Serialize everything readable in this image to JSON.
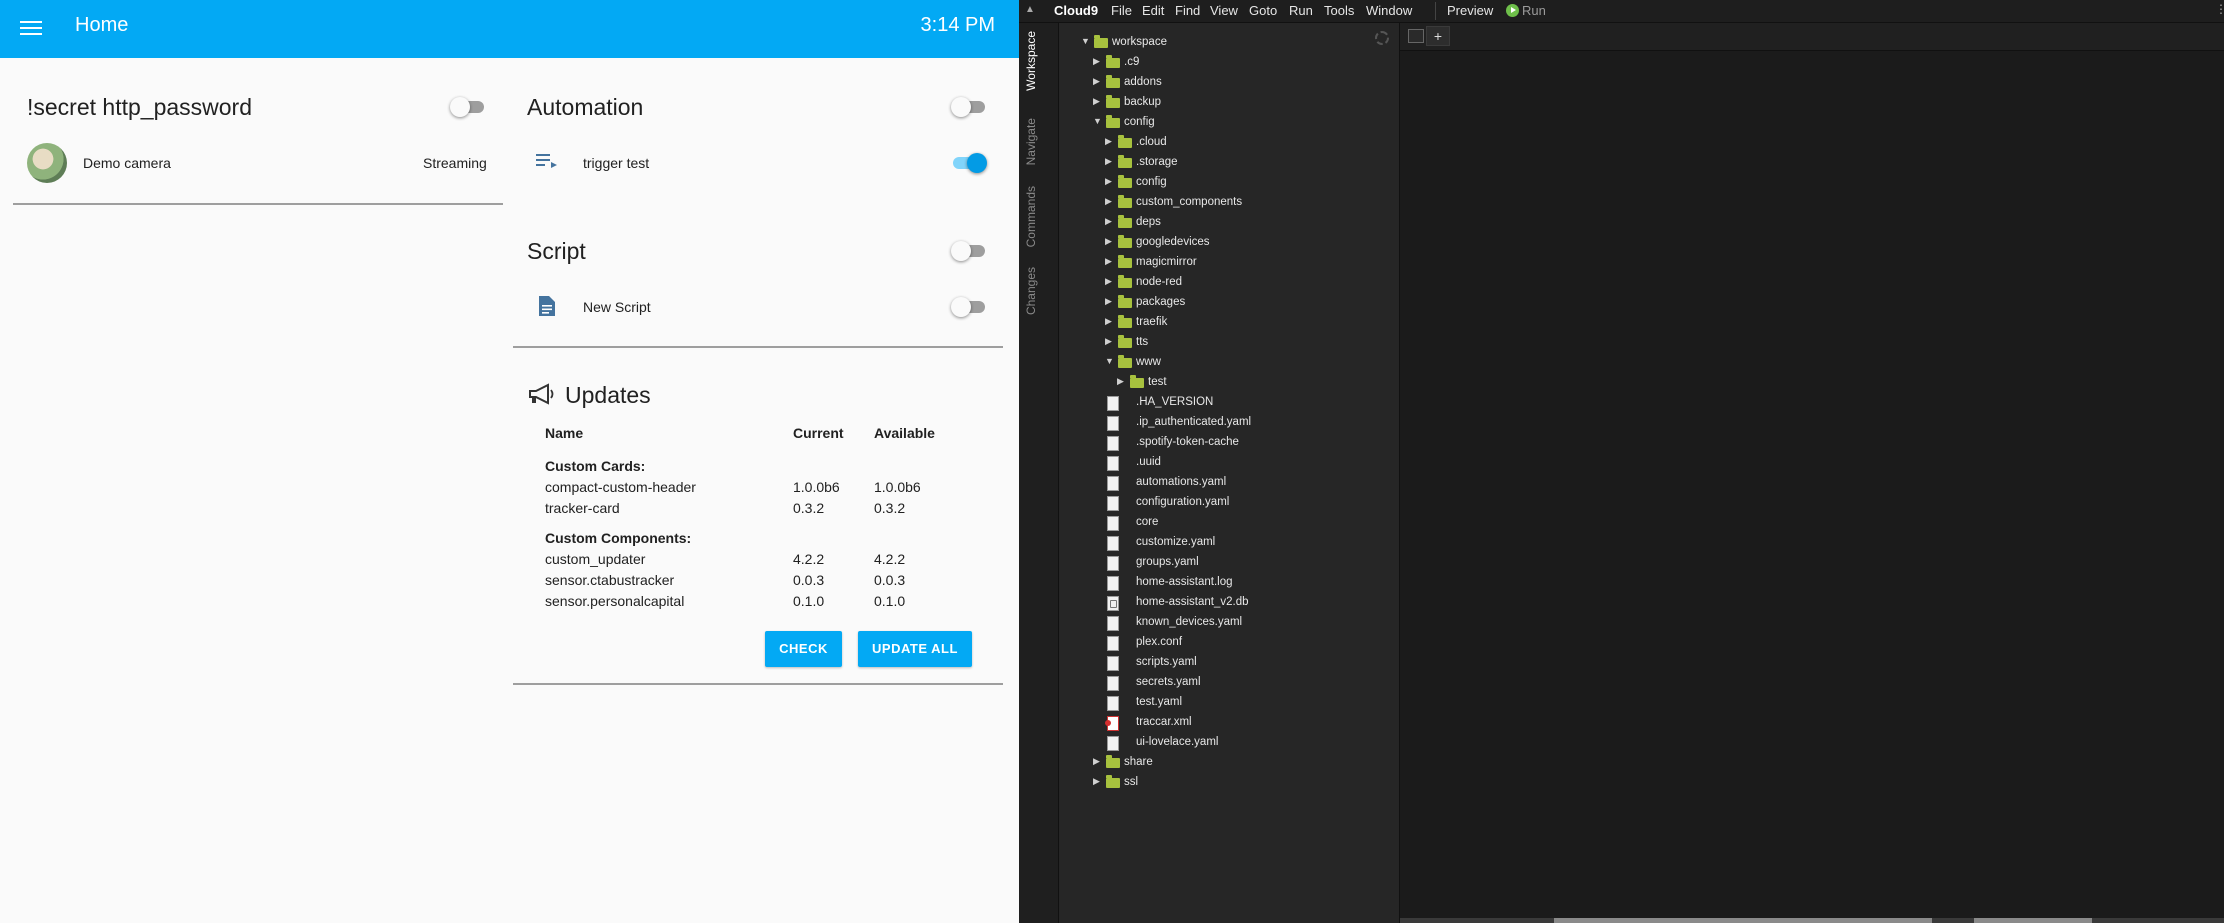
{
  "ha": {
    "header": {
      "title": "Home",
      "clock": "3:14 PM"
    },
    "cards": {
      "secret": {
        "title": "!secret http_password",
        "row_label": "Demo camera",
        "row_state": "Streaming"
      },
      "automation": {
        "title": "Automation",
        "row_label": "trigger test"
      },
      "script": {
        "title": "Script",
        "row_label": "New Script"
      },
      "updates": {
        "title": "Updates",
        "headers": {
          "name": "Name",
          "current": "Current",
          "available": "Available"
        },
        "sections": [
          {
            "label": "Custom Cards:",
            "items": [
              {
                "name": "compact-custom-header",
                "current": "1.0.0b6",
                "available": "1.0.0b6"
              },
              {
                "name": "tracker-card",
                "current": "0.3.2",
                "available": "0.3.2"
              }
            ]
          },
          {
            "label": "Custom Components:",
            "items": [
              {
                "name": "custom_updater",
                "current": "4.2.2",
                "available": "4.2.2"
              },
              {
                "name": "sensor.ctabustracker",
                "current": "0.0.3",
                "available": "0.0.3"
              },
              {
                "name": "sensor.personalcapital",
                "current": "0.1.0",
                "available": "0.1.0"
              }
            ]
          }
        ],
        "buttons": {
          "check": "CHECK",
          "update_all": "UPDATE ALL"
        }
      }
    },
    "toggles": {
      "secret_header": false,
      "automation_header": false,
      "trigger_test": true,
      "script_header": false,
      "new_script": false
    },
    "colors": {
      "accent": "#03a9f4",
      "toggle_on": "#039be5"
    }
  },
  "c9": {
    "menu": [
      "Cloud9",
      "File",
      "Edit",
      "Find",
      "View",
      "Goto",
      "Run",
      "Tools",
      "Window"
    ],
    "preview": "Preview",
    "run": "Run",
    "side_tabs": [
      "Workspace",
      "Navigate",
      "Commands",
      "Changes"
    ],
    "tree": [
      {
        "label": "workspace",
        "type": "folder",
        "depth": 0,
        "open": true
      },
      {
        "label": ".c9",
        "type": "folder",
        "depth": 1,
        "open": false
      },
      {
        "label": "addons",
        "type": "folder",
        "depth": 1,
        "open": false
      },
      {
        "label": "backup",
        "type": "folder",
        "depth": 1,
        "open": false
      },
      {
        "label": "config",
        "type": "folder",
        "depth": 1,
        "open": true
      },
      {
        "label": ".cloud",
        "type": "folder",
        "depth": 2,
        "open": false
      },
      {
        "label": ".storage",
        "type": "folder",
        "depth": 2,
        "open": false
      },
      {
        "label": "config",
        "type": "folder",
        "depth": 2,
        "open": false
      },
      {
        "label": "custom_components",
        "type": "folder",
        "depth": 2,
        "open": false
      },
      {
        "label": "deps",
        "type": "folder",
        "depth": 2,
        "open": false
      },
      {
        "label": "googledevices",
        "type": "folder",
        "depth": 2,
        "open": false
      },
      {
        "label": "magicmirror",
        "type": "folder",
        "depth": 2,
        "open": false
      },
      {
        "label": "node-red",
        "type": "folder",
        "depth": 2,
        "open": false
      },
      {
        "label": "packages",
        "type": "folder",
        "depth": 2,
        "open": false
      },
      {
        "label": "traefik",
        "type": "folder",
        "depth": 2,
        "open": false
      },
      {
        "label": "tts",
        "type": "folder",
        "depth": 2,
        "open": false
      },
      {
        "label": "www",
        "type": "folder",
        "depth": 2,
        "open": true
      },
      {
        "label": "test",
        "type": "folder",
        "depth": 3,
        "open": false
      },
      {
        "label": ".HA_VERSION",
        "type": "file",
        "depth": 2
      },
      {
        "label": ".ip_authenticated.yaml",
        "type": "file",
        "depth": 2
      },
      {
        "label": ".spotify-token-cache",
        "type": "file",
        "depth": 2
      },
      {
        "label": ".uuid",
        "type": "file",
        "depth": 2
      },
      {
        "label": "automations.yaml",
        "type": "file",
        "depth": 2
      },
      {
        "label": "configuration.yaml",
        "type": "file",
        "depth": 2
      },
      {
        "label": "core",
        "type": "file",
        "depth": 2
      },
      {
        "label": "customize.yaml",
        "type": "file",
        "depth": 2
      },
      {
        "label": "groups.yaml",
        "type": "file",
        "depth": 2
      },
      {
        "label": "home-assistant.log",
        "type": "file",
        "depth": 2
      },
      {
        "label": "home-assistant_v2.db",
        "type": "db",
        "depth": 2
      },
      {
        "label": "known_devices.yaml",
        "type": "file",
        "depth": 2
      },
      {
        "label": "plex.conf",
        "type": "file",
        "depth": 2
      },
      {
        "label": "scripts.yaml",
        "type": "file",
        "depth": 2
      },
      {
        "label": "secrets.yaml",
        "type": "file",
        "depth": 2
      },
      {
        "label": "test.yaml",
        "type": "file",
        "depth": 2
      },
      {
        "label": "traccar.xml",
        "type": "xml",
        "depth": 2
      },
      {
        "label": "ui-lovelace.yaml",
        "type": "file",
        "depth": 2
      },
      {
        "label": "share",
        "type": "folder",
        "depth": 1,
        "open": false
      },
      {
        "label": "ssl",
        "type": "folder",
        "depth": 1,
        "open": false
      }
    ],
    "new_tab": "+"
  }
}
